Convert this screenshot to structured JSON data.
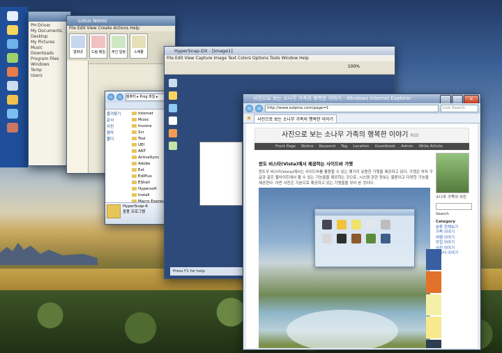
{
  "window2": {
    "tree": [
      "PH Driver",
      "My Documents",
      "Desktop",
      "My Pictures",
      "Music",
      "Downloads",
      "Program Files",
      "Windows",
      "Temp",
      "Users"
    ]
  },
  "window3": {
    "title": "Lotus Notes",
    "menu": "File  Edit  View  Create  Actions  Help",
    "toolbar": [
      "알파넷",
      "드림 메일",
      "주간 일정",
      "스케줄"
    ]
  },
  "explorer": {
    "address": "컴퓨터 ▸ Prog 파일 ▸",
    "favorites": [
      "즐겨찾기",
      "문서",
      "사진",
      "음악",
      "폴더"
    ],
    "folders": [
      "Internet",
      "Music",
      "Invoice",
      "Scr",
      "Tool",
      "UEI",
      "ANT",
      "ActiveSync",
      "Adobe",
      "Ext",
      "EdiPlus",
      "EShell",
      "Hypersoft",
      "Install",
      "Macro Express"
    ],
    "details_name": "HyperSnap-6",
    "details_sub": "응용 프로그램"
  },
  "editor": {
    "title": "HyperSnap-DX - [Image1]",
    "menu": "File  Edit  View  Capture  Image  Text  Colors  Options  Tools  Window  Help",
    "zoom": "100%",
    "hint": "Press F1 for help"
  },
  "ie": {
    "title": "사진으로 보는 소나무 가족의 행복한 이야기 - Windows Internet Explorer",
    "url": "http://www.solpine.com/page=1",
    "search": "Live Search",
    "tab": "사진으로 보는 소나무 가족의 행복한 이야기",
    "blog_title": "사진으로 보는 소나무 가족의 행복한 이야기",
    "blog_rss": "RSS",
    "nav": [
      "Front Page",
      "Notice",
      "Keyword",
      "Tag",
      "Location",
      "Guestbook",
      "Admin",
      "Write Article"
    ],
    "post_title": "윈도 비스타(Vista)에서 제공하는 사이드바 가젯",
    "post_text": "윈도우 비스타(Vista)에서는 사이드바를 활용할 수 있는 몇가지 유용한 가젯을 제공하고 있다. 가젯은 마치 구글과 같은 웹사이트에서 볼 수 있는 기능들을 제공하는 것으로, 시스템 관련 정보는 물론이고 다양한 기능을 제공한다. 이번 사진은 기본으로 제공하고 있는 가젯들을 모아 본 것이다.",
    "side_caption": "소나무 가족의 사진",
    "side_search": "Search",
    "side_category": "Category",
    "side_items": [
      "분류 전체보기",
      "가족 이야기",
      "여행 이야기",
      "맛집 이야기",
      "사진 이야기",
      "컴퓨터 이야기"
    ]
  },
  "colors": {
    "ie_frame": "#2b4463",
    "tab_accent": "#9fb2cc",
    "photo_orange": "#e2722b"
  }
}
